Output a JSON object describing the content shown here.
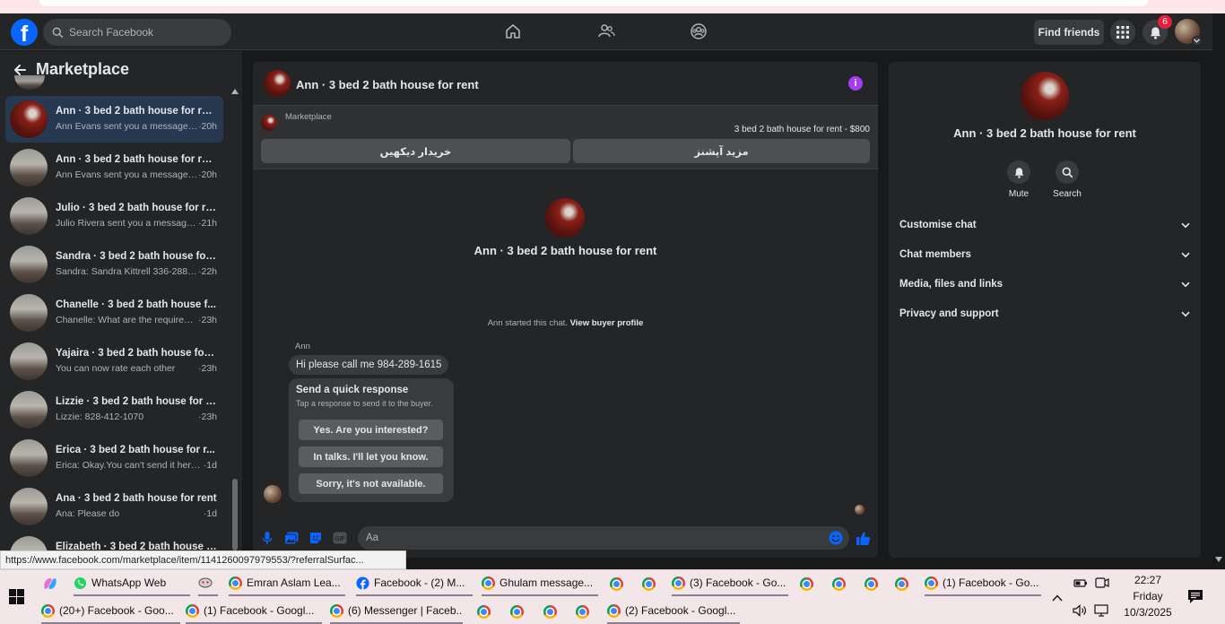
{
  "header": {
    "search_placeholder": "Search Facebook",
    "find_friends": "Find friends",
    "notifications_count": "6"
  },
  "sidebar": {
    "title": "Marketplace",
    "conversations": [
      {
        "name": "Ann · 3 bed 2 bath house for rent",
        "snippet": "Ann Evans sent you a message a...",
        "time": "·20h",
        "active": true
      },
      {
        "name": "Ann · 3 bed 2 bath house for rent",
        "snippet": "Ann Evans sent you a message a...",
        "time": "·20h"
      },
      {
        "name": "Julio · 3 bed 2 bath house for re...",
        "snippet": "Julio Rivera sent you a message a...",
        "time": "·21h"
      },
      {
        "name": "Sandra · 3 bed 2 bath house for...",
        "snippet": "Sandra: Sandra Kittrell 336-288-0...",
        "time": "·22h"
      },
      {
        "name": "Chanelle · 3 bed 2 bath house f...",
        "snippet": "Chanelle: What are the requirem...",
        "time": "·23h"
      },
      {
        "name": "Yajaira · 3 bed 2 bath house for ...",
        "snippet": "You can now rate each other",
        "time": "·23h"
      },
      {
        "name": "Lizzie · 3 bed 2 bath house for r...",
        "snippet": "Lizzie: 828-412-1070",
        "time": "·23h"
      },
      {
        "name": "Erica · 3 bed 2 bath house for r...",
        "snippet": "Erica: Okay.You can't send it here??",
        "time": "·1d"
      },
      {
        "name": "Ana · 3 bed 2 bath house for rent",
        "snippet": "Ana: Please do",
        "time": "·1d"
      },
      {
        "name": "Elizabeth · 3 bed 2 bath house f...",
        "snippet": "",
        "time": ""
      }
    ]
  },
  "chat": {
    "title": "Ann · 3 bed 2 bath house for rent",
    "marketplace_label": "Marketplace",
    "listing_price": "3 bed 2 bath house for rent - $800",
    "button_left": "خریدار دیکھیں",
    "button_right": "مزید آپشنز",
    "intro_name": "Ann · 3 bed 2 bath house for rent",
    "started_text": "Ann started this chat.",
    "view_buyer": "View buyer profile",
    "sender": "Ann",
    "message": "Hi please call me 984-289-1615",
    "quick_title": "Send a quick response",
    "quick_sub": "Tap a response to send it to the buyer.",
    "quick_options": [
      "Yes. Are you interested?",
      "In talks. I'll let you know.",
      "Sorry, it's not available."
    ],
    "composer_placeholder": "Aa"
  },
  "details": {
    "name": "Ann · 3 bed 2 bath house for rent",
    "mute": "Mute",
    "search": "Search",
    "sections": [
      "Customise chat",
      "Chat members",
      "Media, files and links",
      "Privacy and support"
    ]
  },
  "status_url": "https://www.facebook.com/marketplace/item/1141260097979553/?referralSurfac...",
  "taskbar": {
    "row1": [
      {
        "label": "WhatsApp Web",
        "kind": "whatsapp"
      },
      {
        "label": "",
        "kind": "app"
      },
      {
        "label": "Emran Aslam Lea...",
        "kind": "chrome"
      },
      {
        "label": "Facebook - (2) M...",
        "kind": "facebook"
      },
      {
        "label": "Ghulam message...",
        "kind": "chrome"
      },
      {
        "label": "(3) Facebook - Go...",
        "kind": "chrome"
      },
      {
        "label": "(1) Facebook - Go...",
        "kind": "chrome"
      }
    ],
    "row2": [
      {
        "label": "(20+) Facebook - Goo...",
        "kind": "chrome"
      },
      {
        "label": "(1) Facebook - Googl...",
        "kind": "chrome"
      },
      {
        "label": "(6) Messenger | Faceb...",
        "kind": "chrome"
      },
      {
        "label": "(2) Facebook - Googl...",
        "kind": "chrome"
      }
    ],
    "time": "22:27",
    "day": "Friday",
    "date": "10/3/2025"
  },
  "colors": {
    "accent": "#0866ff",
    "active_row": "#263951",
    "info": "#a33df5",
    "badge": "#e41e3f"
  }
}
